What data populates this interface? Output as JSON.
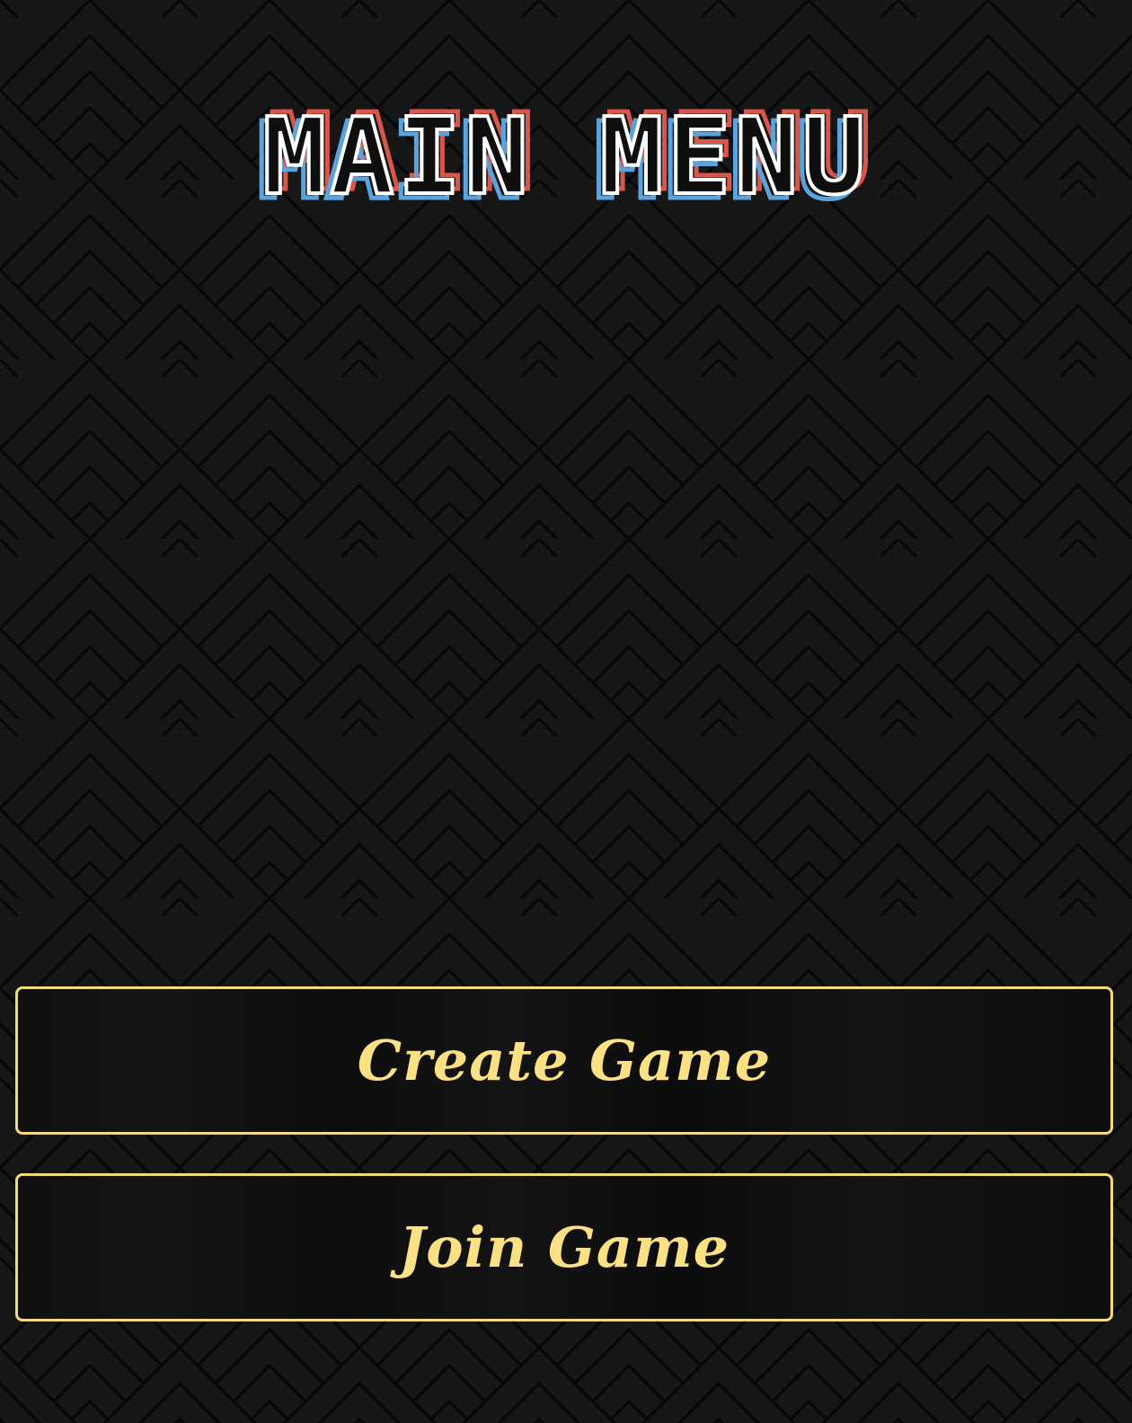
{
  "title": {
    "text": "MAIN MENU",
    "colors": {
      "fill": "#0e0e0e",
      "outline": "#ffffff",
      "shadow_red": "#d9574a",
      "shadow_blue": "#5ba3dd"
    }
  },
  "menu": {
    "buttons": [
      {
        "label": "Create Game"
      },
      {
        "label": "Join Game"
      }
    ],
    "colors": {
      "border": "#f3d97a",
      "text": "#fbe084"
    }
  },
  "background": {
    "pattern": "nested-chevron-diamonds",
    "colors": {
      "base": "#161616",
      "lines": "#050505"
    }
  }
}
